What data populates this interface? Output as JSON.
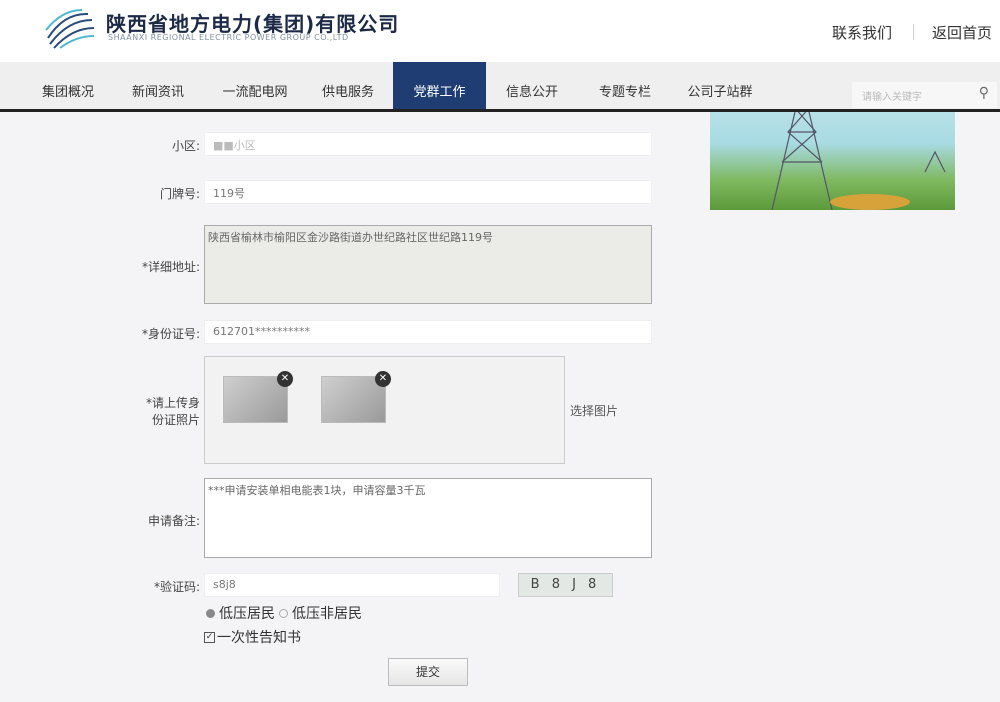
{
  "header": {
    "company_cn": "陕西省地方电力(集团)有限公司",
    "company_en": "SHAANXI REGIONAL ELECTRIC POWER GROUP CO.,LTD",
    "contact": "联系我们",
    "home": "返回首页"
  },
  "nav": {
    "items": [
      "集团概况",
      "新闻资讯",
      "一流配电网",
      "供电服务",
      "党群工作",
      "信息公开",
      "专题专栏",
      "公司子站群"
    ],
    "active": 4,
    "search_placeholder": "请输入关键字",
    "search_icon": "search-icon"
  },
  "form": {
    "community_label": "小区:",
    "community_value": "■■小区",
    "door_label": "门牌号:",
    "door_value": "119号",
    "address_label": "*详细地址:",
    "address_value": "陕西省榆林市榆阳区金沙路街道办世纪路社区世纪路119号",
    "id_label": "*身份证号:",
    "id_value": "612701**********",
    "upload_label": "*请上传身份证照片",
    "choose_image": "选择图片",
    "remark_label": "申请备注:",
    "remark_value": "***申请安装单相电能表1块，申请容量3千瓦",
    "captcha_label": "*验证码:",
    "captcha_value": "s8j8",
    "captcha_image": "B 8 J 8",
    "radio_1": "低压居民",
    "radio_2": "低压非居民",
    "checkbox": "一次性告知书",
    "submit": "提交"
  },
  "colors": {
    "nav_active": "#1f3d72"
  }
}
